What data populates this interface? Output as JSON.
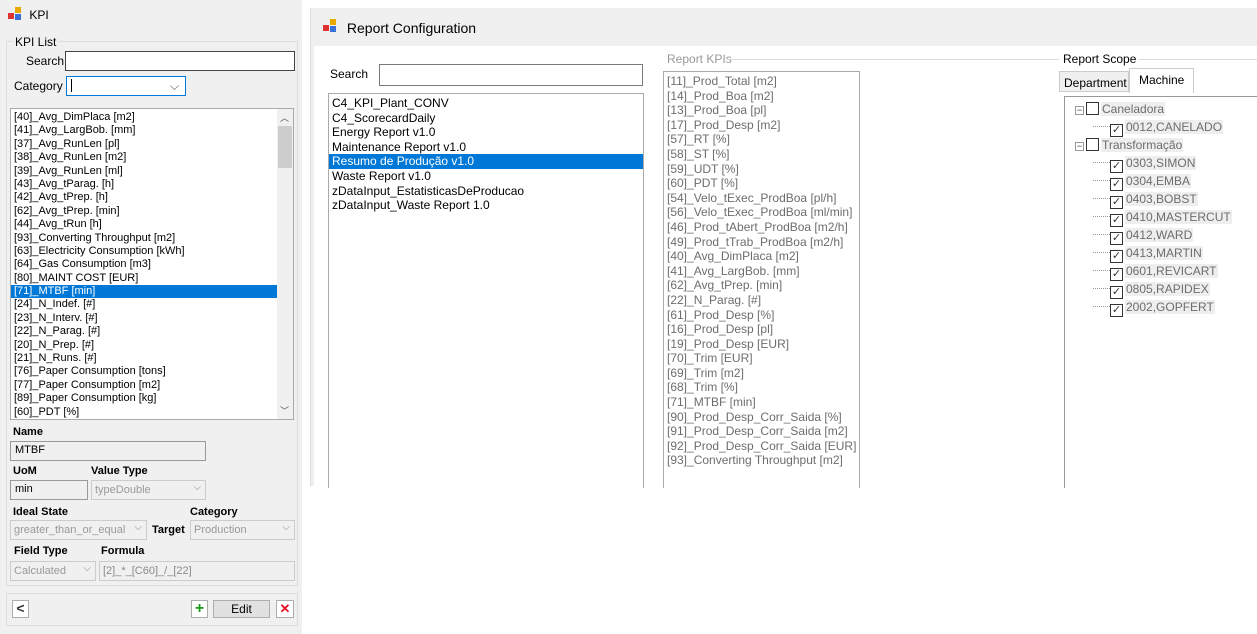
{
  "kpi_window": {
    "title": "KPI",
    "group_title": "KPI List",
    "search_label": "Search",
    "search_value": "",
    "category_label": "Category",
    "category_value": "",
    "items": [
      "[40]_Avg_DimPlaca [m2]",
      "[41]_Avg_LargBob. [mm]",
      "[37]_Avg_RunLen [pl]",
      "[38]_Avg_RunLen [m2]",
      "[39]_Avg_RunLen [ml]",
      "[43]_Avg_tParag. [h]",
      "[42]_Avg_tPrep. [h]",
      "[62]_Avg_tPrep. [min]",
      "[44]_Avg_tRun [h]",
      "[93]_Converting Throughput [m2]",
      "[63]_Electricity Consumption [kWh]",
      "[64]_Gas Consumption [m3]",
      "[80]_MAINT COST [EUR]",
      "[71]_MTBF [min]",
      "[24]_N_Indef. [#]",
      "[23]_N_Interv. [#]",
      "[22]_N_Parag. [#]",
      "[20]_N_Prep. [#]",
      "[21]_N_Runs. [#]",
      "[76]_Paper Consumption [tons]",
      "[77]_Paper Consumption [m2]",
      "[89]_Paper Consumption [kg]",
      "[60]_PDT [%]"
    ],
    "selected_index": 13,
    "name_label": "Name",
    "name_value": "MTBF",
    "uom_label": "UoM",
    "uom_value": "min",
    "value_type_label": "Value Type",
    "value_type_value": "typeDouble",
    "ideal_state_label": "Ideal State",
    "ideal_state_value": "greater_than_or_equal",
    "target_label": "Target",
    "category2_label": "Category",
    "category2_value": "Production",
    "field_type_label": "Field Type",
    "field_type_value": "Calculated",
    "formula_label": "Formula",
    "formula_value": "[2]_*_[C60]_/_[22]",
    "edit_label": "Edit",
    "icons": {
      "share": "share-icon",
      "add": "plus-icon",
      "delete": "close-icon"
    },
    "colors": {
      "selection": "#0078d7",
      "add": "#1a9e1a",
      "delete": "#e81123"
    }
  },
  "report_window": {
    "title": "Report Configuration",
    "search_label": "Search",
    "search_value": "",
    "reports": [
      "C4_KPI_Plant_CONV",
      "C4_ScorecardDaily",
      "Energy Report v1.0",
      "Maintenance Report v1.0",
      "Resumo de Produção v1.0",
      "Waste Report v1.0",
      "zDataInput_EstatisticasDeProducao",
      "zDataInput_Waste Report 1.0"
    ],
    "selected_report_index": 4,
    "report_kpis_title": "Report KPIs",
    "report_kpis": [
      "[11]_Prod_Total [m2]",
      "[14]_Prod_Boa [m2]",
      "[13]_Prod_Boa [pl]",
      "[17]_Prod_Desp [m2]",
      "[57]_RT [%]",
      "[58]_ST [%]",
      "[59]_UDT [%]",
      "[60]_PDT [%]",
      "[54]_Velo_tExec_ProdBoa [pl/h]",
      "[56]_Velo_tExec_ProdBoa [ml/min]",
      "[46]_Prod_tAbert_ProdBoa [m2/h]",
      "[49]_Prod_tTrab_ProdBoa [m2/h]",
      "[40]_Avg_DimPlaca [m2]",
      "[41]_Avg_LargBob. [mm]",
      "[62]_Avg_tPrep. [min]",
      "[22]_N_Parag. [#]",
      "[61]_Prod_Desp [%]",
      "[16]_Prod_Desp [pl]",
      "[19]_Prod_Desp [EUR]",
      "[70]_Trim [EUR]",
      "[69]_Trim [m2]",
      "[68]_Trim [%]",
      "[71]_MTBF [min]",
      "[90]_Prod_Desp_Corr_Saida [%]",
      "[91]_Prod_Desp_Corr_Saida [m2]",
      "[92]_Prod_Desp_Corr_Saida [EUR]",
      "[93]_Converting Throughput [m2]"
    ],
    "scope_title": "Report Scope",
    "tabs": [
      "Department",
      "Machine"
    ],
    "active_tab": 1,
    "tree": [
      {
        "label": "Caneladora",
        "checked": false,
        "children": [
          {
            "label": "0012,CANELADO",
            "checked": true
          }
        ]
      },
      {
        "label": "Transformação",
        "checked": false,
        "children": [
          {
            "label": "0303,SIMON",
            "checked": true
          },
          {
            "label": "0304,EMBA",
            "checked": true
          },
          {
            "label": "0403,BOBST",
            "checked": true
          },
          {
            "label": "0410,MASTERCUT",
            "checked": true
          },
          {
            "label": "0412,WARD",
            "checked": true
          },
          {
            "label": "0413,MARTIN",
            "checked": true
          },
          {
            "label": "0601,REVICART",
            "checked": true
          },
          {
            "label": "0805,RAPIDEX",
            "checked": true
          },
          {
            "label": "2002,GOPFERT",
            "checked": true
          }
        ]
      }
    ]
  }
}
